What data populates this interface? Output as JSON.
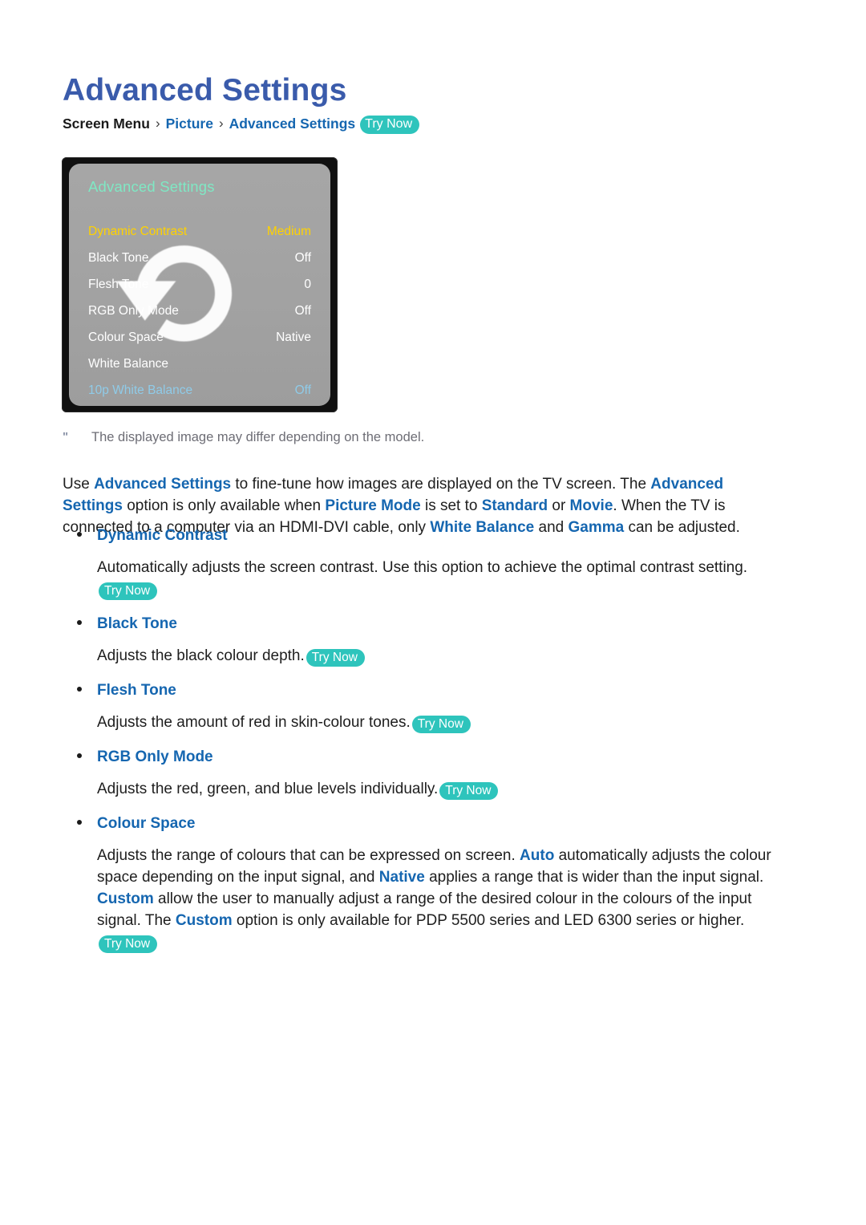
{
  "page": {
    "title": "Advanced Settings"
  },
  "breadcrumb": {
    "root": "Screen Menu",
    "sep": "›",
    "level1": "Picture",
    "level2": "Advanced Settings",
    "try_now": "Try Now"
  },
  "tv_screenshot": {
    "panel_title": "Advanced Settings",
    "icon": "refresh-undo-arrow-icon",
    "rows": [
      {
        "label": "Dynamic Contrast",
        "value": "Medium",
        "state": "selected"
      },
      {
        "label": "Black Tone",
        "value": "Off",
        "state": "normal"
      },
      {
        "label": "Flesh Tone",
        "value": "0",
        "state": "normal"
      },
      {
        "label": "RGB Only Mode",
        "value": "Off",
        "state": "normal"
      },
      {
        "label": "Colour Space",
        "value": "Native",
        "state": "normal"
      },
      {
        "label": "White Balance",
        "value": "",
        "state": "normal"
      },
      {
        "label": "10p White Balance",
        "value": "Off",
        "state": "dimmed"
      }
    ]
  },
  "note": {
    "marker": "\"",
    "text": "The displayed image may differ depending on the model."
  },
  "intro": {
    "t1": "Use ",
    "k1": "Advanced Settings",
    "t2": " to fine-tune how images are displayed on the TV screen. The ",
    "k2": "Advanced Settings",
    "t3": " option is only available when ",
    "k3": "Picture Mode",
    "t4": " is set to ",
    "k4": "Standard",
    "t5": " or ",
    "k5": "Movie",
    "t6": ". When the TV is connected to a computer via an HDMI-DVI cable, only ",
    "k6": "White Balance",
    "t7": " and ",
    "k7": "Gamma",
    "t8": " can be adjusted."
  },
  "sections": {
    "dynamic_contrast": {
      "heading": "Dynamic Contrast",
      "body": "Automatically adjusts the screen contrast. Use this option to achieve the optimal contrast setting.",
      "try_now": "Try Now"
    },
    "black_tone": {
      "heading": "Black Tone",
      "body": "Adjusts the black colour depth.",
      "try_now": "Try Now"
    },
    "flesh_tone": {
      "heading": "Flesh Tone",
      "body": "Adjusts the amount of red in skin-colour tones.",
      "try_now": "Try Now"
    },
    "rgb_only_mode": {
      "heading": "RGB Only Mode",
      "body": "Adjusts the red, green, and blue levels individually.",
      "try_now": "Try Now"
    },
    "colour_space": {
      "heading": "Colour Space",
      "p1": "Adjusts the range of colours that can be expressed on screen. ",
      "k1": "Auto",
      "p2": " automatically adjusts the colour space depending on the input signal, and ",
      "k2": "Native",
      "p3": " applies a range that is wider than the input signal. ",
      "k3": "Custom",
      "p4": " allow the user to manually adjust a range of the desired colour in the colours of the input signal. The ",
      "k4": "Custom",
      "p5": " option is only available for PDP 5500 series and LED 6300 series or higher.",
      "try_now": "Try Now"
    }
  },
  "colors": {
    "title_blue": "#3a5bab",
    "link_blue": "#1566b0",
    "try_now_teal": "#2ec4bc",
    "panel_gray": "#a3a3a3",
    "panel_title_mint": "#7fe8c4",
    "panel_selected_yellow": "#ffd200",
    "panel_dimmed_blue": "#8fcbe8",
    "note_gray": "#6d6d75"
  }
}
